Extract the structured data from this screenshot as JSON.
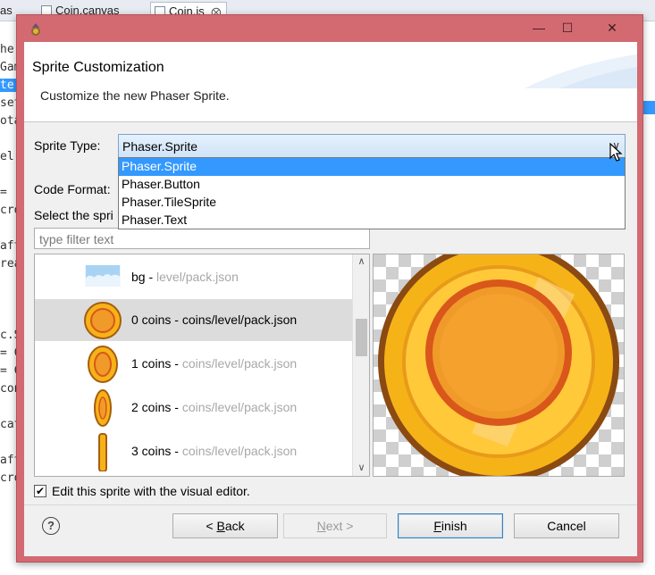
{
  "background_ide": {
    "tabs": [
      {
        "label": "as"
      },
      {
        "label": "Coin.canvas"
      },
      {
        "label": "Coin.js"
      }
    ],
    "code_fragments": [
      "he",
      "Gam",
      "te",
      "set",
      "ota",
      "el",
      "=",
      "cro",
      "aft",
      "rea",
      "c.S",
      "= C",
      "= C",
      "con",
      "cat",
      "aft",
      "cro"
    ]
  },
  "dialog": {
    "window_controls": {
      "minimize": "—",
      "maximize": "☐",
      "close": "✕"
    },
    "title": "Sprite Customization",
    "description": "Customize the new Phaser Sprite.",
    "sprite_type": {
      "label": "Sprite Type:",
      "value": "Phaser.Sprite",
      "options": [
        "Phaser.Sprite",
        "Phaser.Button",
        "Phaser.TileSprite",
        "Phaser.Text"
      ]
    },
    "code_format": {
      "label": "Code Format:"
    },
    "select_label": "Select the spri",
    "filter_placeholder": "type filter text",
    "sprites": [
      {
        "name": "bg",
        "source": "level/pack.json",
        "selected": false
      },
      {
        "name": "0 coins",
        "source": "coins/level/pack.json",
        "selected": true
      },
      {
        "name": "1 coins",
        "source": "coins/level/pack.json",
        "selected": false
      },
      {
        "name": "2 coins",
        "source": "coins/level/pack.json",
        "selected": false
      },
      {
        "name": "3 coins",
        "source": "coins/level/pack.json",
        "selected": false
      }
    ],
    "edit_visual": {
      "label": "Edit this sprite with the visual editor.",
      "checked": true
    },
    "buttons": {
      "help": "?",
      "back": "< Back",
      "back_mnemonic": "B",
      "next": "Next >",
      "next_mnemonic": "N",
      "finish": "Finish",
      "finish_mnemonic": "F",
      "cancel": "Cancel"
    },
    "colors": {
      "titlebar": "#d36a72",
      "selection": "#3399ff",
      "coin_gold": "#f6b318"
    }
  }
}
